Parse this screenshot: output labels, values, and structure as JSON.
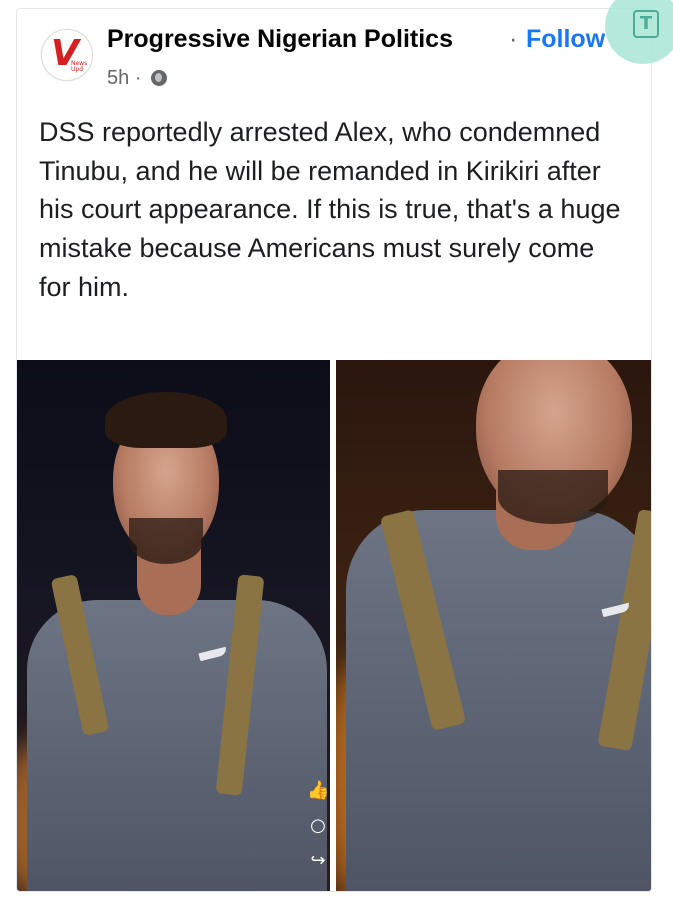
{
  "post": {
    "page_name": "Progressive Nigerian Politics",
    "separator": "·",
    "follow_label": "Follow",
    "time": "5h",
    "meta_separator": "·",
    "privacy_icon": "globe-icon",
    "text": "DSS reportedly arrested Alex, who condemned Tinubu, and he will be remanded in Kirikiri after his court appearance. If this is true, that's a huge mistake because Americans must surely come for him."
  },
  "logo": {
    "letter": "V",
    "subtext": "News Upd"
  },
  "actions": [
    {
      "icon": "thumbs-up-icon",
      "glyph": "👍"
    },
    {
      "icon": "comment-icon",
      "glyph": "○"
    },
    {
      "icon": "share-icon",
      "glyph": "↪"
    }
  ],
  "watermark": {
    "letter": "T"
  },
  "colors": {
    "accent": "#1877f2",
    "text": "#1c1e21",
    "muted": "#65676b"
  }
}
